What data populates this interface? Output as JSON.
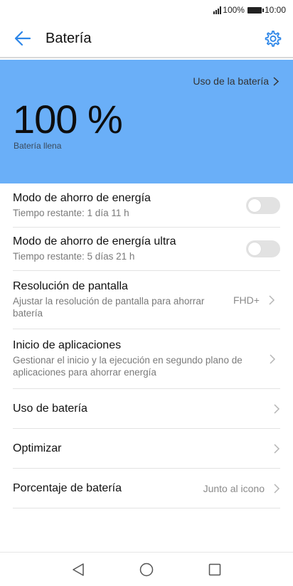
{
  "status_bar": {
    "battery_percent": "100%",
    "time": "10:00"
  },
  "app_bar": {
    "title": "Batería",
    "back_icon": "arrow-back-icon",
    "settings_icon": "gear-icon",
    "accent_color": "#2d86e8"
  },
  "hero": {
    "background_color": "#6aaff8",
    "usage_link": "Uso de la batería",
    "percent": "100 %",
    "status": "Batería llena"
  },
  "settings": [
    {
      "title": "Modo de ahorro de energía",
      "subtitle": "Tiempo restante: 1 día 11 h",
      "control": "toggle",
      "enabled": false
    },
    {
      "title": "Modo de ahorro de energía ultra",
      "subtitle": "Tiempo restante: 5 días 21 h",
      "control": "toggle",
      "enabled": false
    },
    {
      "title": "Resolución de pantalla",
      "subtitle": "Ajustar la resolución de pantalla para ahorrar batería",
      "value": "FHD+",
      "control": "chevron"
    },
    {
      "title": "Inicio de aplicaciones",
      "subtitle": "Gestionar el inicio y la ejecución en segundo plano de aplicaciones para ahorrar energía",
      "control": "chevron"
    },
    {
      "title": "Uso de batería",
      "control": "chevron"
    },
    {
      "title": "Optimizar",
      "control": "chevron"
    },
    {
      "title": "Porcentaje de batería",
      "value": "Junto al icono",
      "control": "chevron"
    }
  ],
  "nav_bar": {
    "icons": [
      "back-triangle-icon",
      "home-circle-icon",
      "recents-square-icon"
    ]
  }
}
